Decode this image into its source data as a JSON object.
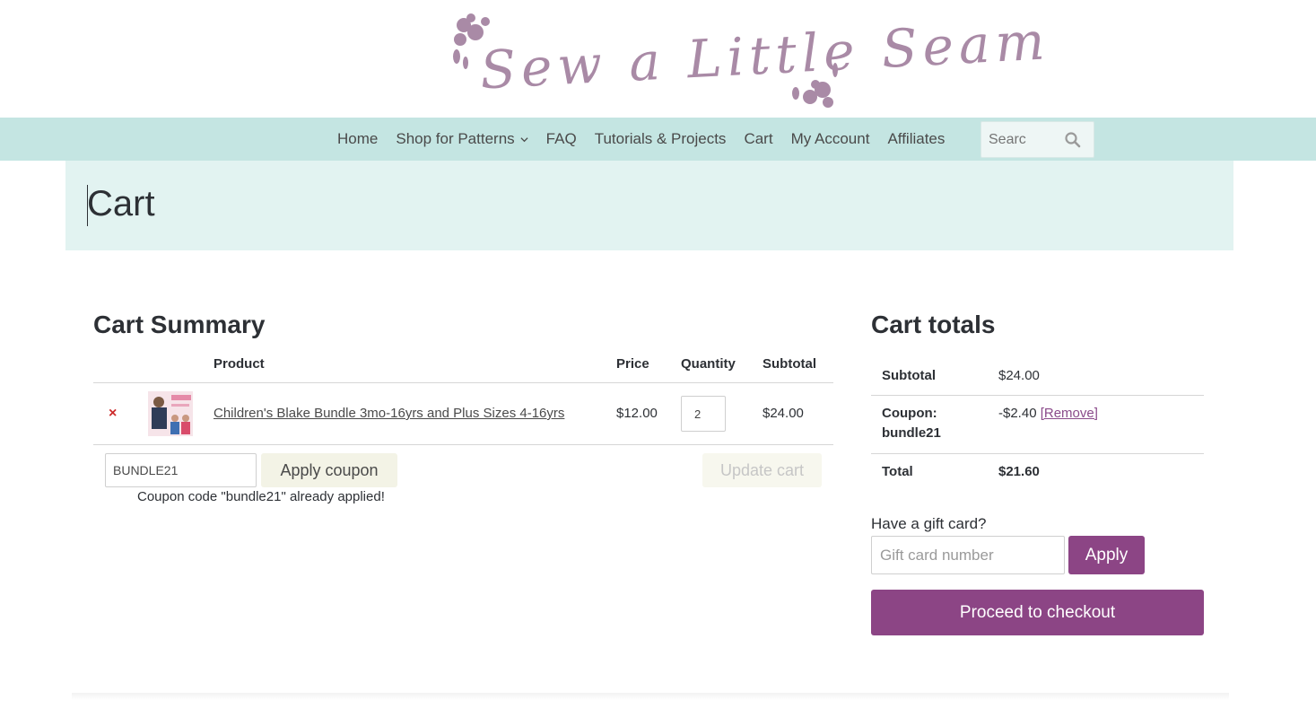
{
  "site": {
    "logo_text": "Sew a Little Seam"
  },
  "nav": {
    "items": [
      "Home",
      "Shop for Patterns",
      "FAQ",
      "Tutorials & Projects",
      "Cart",
      "My Account",
      "Affiliates"
    ],
    "search_placeholder": "Searc"
  },
  "page": {
    "title": "Cart"
  },
  "summary": {
    "heading": "Cart Summary",
    "columns": {
      "product": "Product",
      "price": "Price",
      "quantity": "Quantity",
      "subtotal": "Subtotal"
    },
    "item": {
      "remove": "×",
      "name": "Children's Blake Bundle 3mo-16yrs and Plus Sizes 4-16yrs",
      "price": "$12.00",
      "quantity": "2",
      "subtotal": "$24.00"
    },
    "coupon_value": "BUNDLE21",
    "apply_coupon_label": "Apply coupon",
    "update_cart_label": "Update cart",
    "coupon_note": "Coupon code \"bundle21\" already applied!"
  },
  "totals": {
    "heading": "Cart totals",
    "subtotal_label": "Subtotal",
    "subtotal_value": "$24.00",
    "coupon_label": "Coupon: bundle21",
    "coupon_value": "-$2.40",
    "coupon_remove": "[Remove]",
    "total_label": "Total",
    "total_value": "$21.60",
    "gift_label": "Have a gift card?",
    "gift_placeholder": "Gift card number",
    "gift_apply": "Apply",
    "checkout_label": "Proceed to checkout"
  },
  "colors": {
    "nav_bg": "#c4e5e2",
    "title_band": "#e2f3f1",
    "accent": "#8c4585",
    "logo": "#a98aa6"
  },
  "icons": {
    "search": "search-icon",
    "dropdown": "chevron-down-icon",
    "logo_flowers": "flower-icon"
  }
}
